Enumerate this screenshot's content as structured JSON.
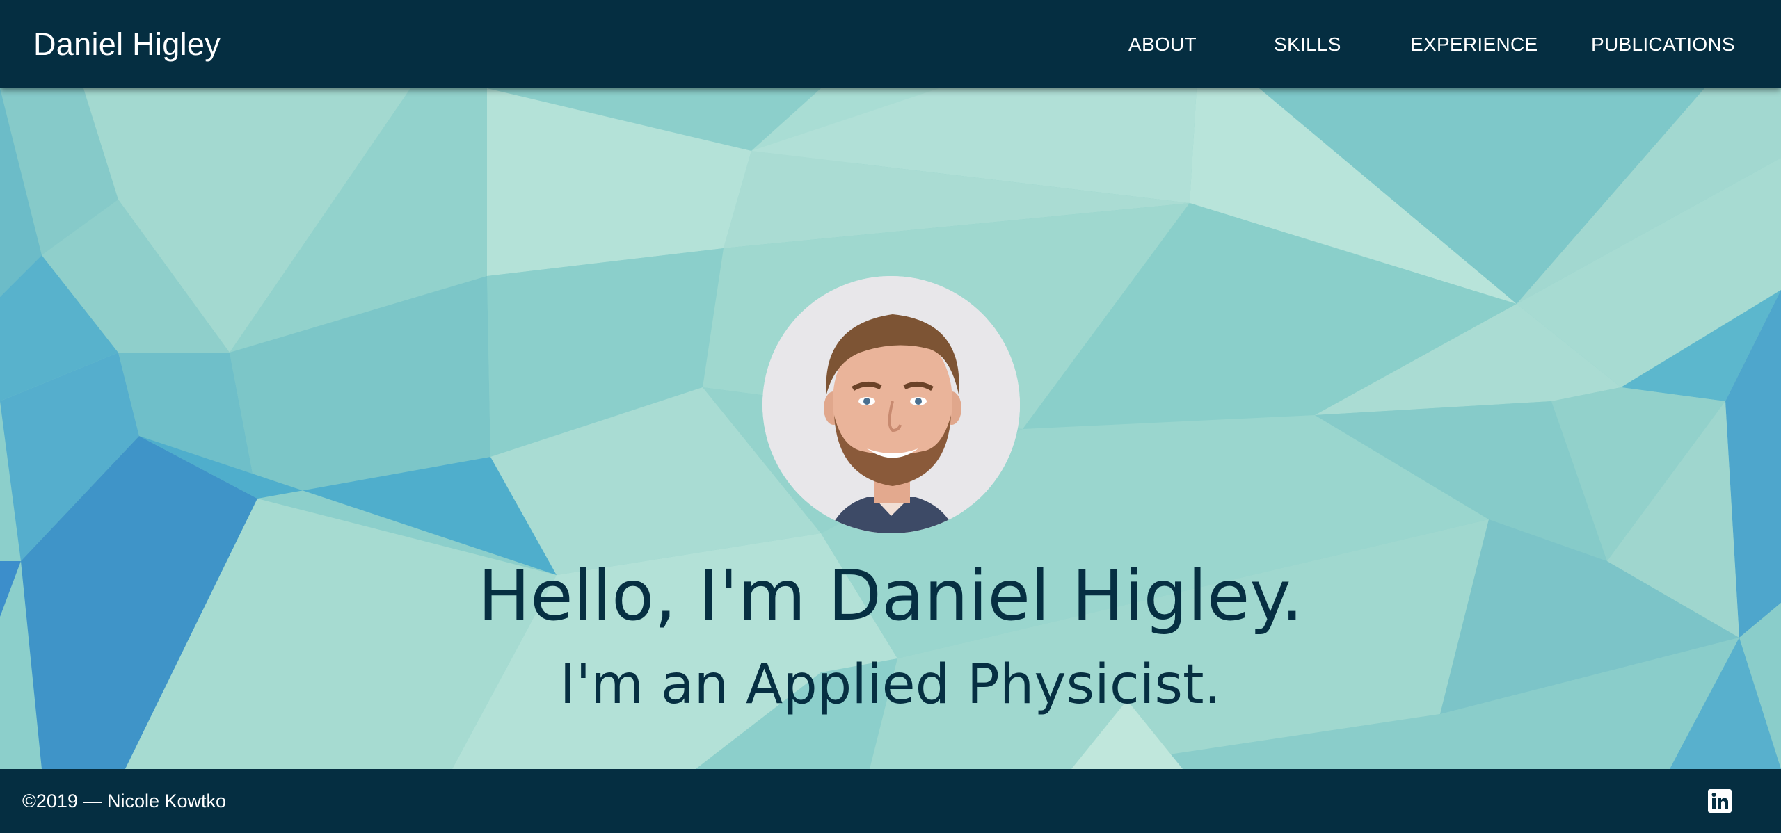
{
  "header": {
    "brand": "Daniel Higley",
    "nav": {
      "about": "ABOUT",
      "skills": "SKILLS",
      "experience": "EXPERIENCE",
      "publications": "PUBLICATIONS"
    }
  },
  "hero": {
    "headline": "Hello, I'm Daniel Higley.",
    "subheadline": "I'm an Applied Physicist."
  },
  "footer": {
    "copyright": "©2019 — Nicole Kowtko",
    "social_icon": "linkedin-icon"
  },
  "colors": {
    "navbar": "#052e41",
    "headline_text": "#062f42",
    "hero_base": "#8ccfcb"
  }
}
